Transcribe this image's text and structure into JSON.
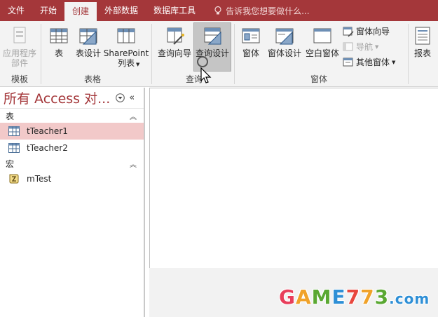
{
  "tabs": [
    {
      "label": "文件",
      "active": false
    },
    {
      "label": "开始",
      "active": false
    },
    {
      "label": "创建",
      "active": true
    },
    {
      "label": "外部数据",
      "active": false
    },
    {
      "label": "数据库工具",
      "active": false
    }
  ],
  "tellme": {
    "text": "告诉我您想要做什么..."
  },
  "ribbon": {
    "groups": {
      "template": {
        "label": "模板",
        "app_parts": "应用程序\n部件"
      },
      "tables": {
        "label": "表格",
        "table": "表",
        "table_design": "表设计",
        "sharepoint": "SharePoint\n列表"
      },
      "queries": {
        "label": "查询",
        "query_wizard": "查询向导",
        "query_design": "查询设计"
      },
      "forms": {
        "label": "窗体",
        "form": "窗体",
        "form_design": "窗体设计",
        "blank_form": "空白窗体",
        "form_wizard": "窗体向导",
        "navigation": "导航",
        "more_forms": "其他窗体"
      },
      "reports": {
        "report": "报表"
      }
    }
  },
  "nav": {
    "title": "所有 Access 对...",
    "sections": [
      {
        "label": "表",
        "items": [
          "tTeacher1",
          "tTeacher2"
        ]
      },
      {
        "label": "宏",
        "items": [
          "mTest"
        ]
      }
    ]
  },
  "watermark": {
    "g": "G",
    "a": "A",
    "m": "M",
    "e": "E",
    "n7a": "7",
    "n7b": "7",
    "n3": "3",
    "dot": ".",
    "com": "com"
  },
  "colors": {
    "accent": "#a4373a",
    "ribbon_bg": "#f3f3f3",
    "selected_row": "#f2c9c9"
  }
}
